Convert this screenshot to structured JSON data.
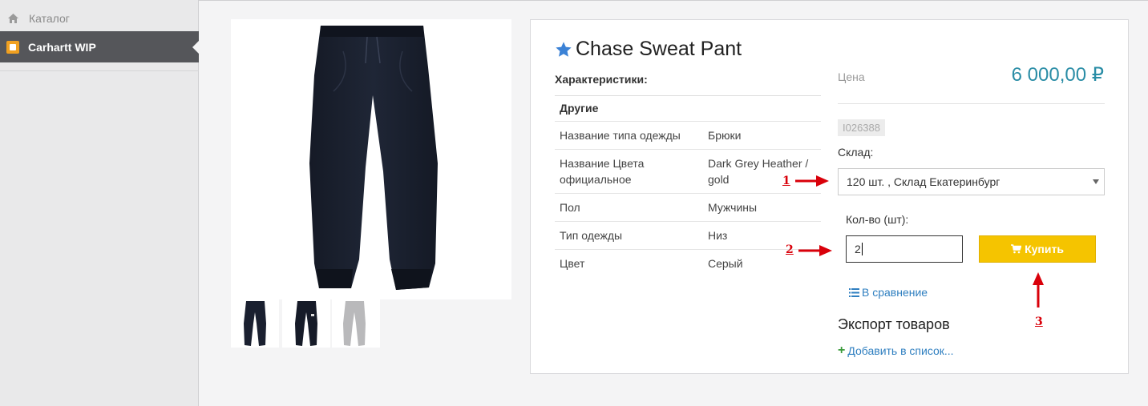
{
  "sidebar": {
    "breadcrumb": "Каталог",
    "active_item": "Carhartt WIP"
  },
  "product": {
    "title": "Chase Sweat Pant",
    "specs_title": "Характеристики:",
    "spec_group": "Другие",
    "specs": [
      {
        "key": "Название типа одежды",
        "value": "Брюки"
      },
      {
        "key": "Название Цвета официальное",
        "value": "Dark Grey Heather / gold"
      },
      {
        "key": "Пол",
        "value": "Мужчины"
      },
      {
        "key": "Тип одежды",
        "value": "Низ"
      },
      {
        "key": "Цвет",
        "value": "Серый"
      }
    ],
    "price_label": "Цена",
    "price": "6 000,00 ₽",
    "sku": "I026388",
    "stock_label": "Склад:",
    "stock_selected": "120 шт. , Склад Екатеринбург",
    "qty_label": "Кол-во (шт):",
    "qty_value": "2",
    "buy_label": "Купить",
    "compare_label": "В сравнение",
    "export_title": "Экспорт товаров",
    "add_to_list_label": "Добавить в список..."
  },
  "annotations": [
    "1",
    "2",
    "3"
  ],
  "colors": {
    "price": "#2a8da6",
    "buy_button": "#f5c400",
    "link": "#2f7fc0",
    "annotation": "#d9000a"
  },
  "icons": [
    "home-icon",
    "brand-icon",
    "star-icon",
    "cart-icon",
    "list-icon",
    "plus-icon",
    "caret-down-icon"
  ]
}
